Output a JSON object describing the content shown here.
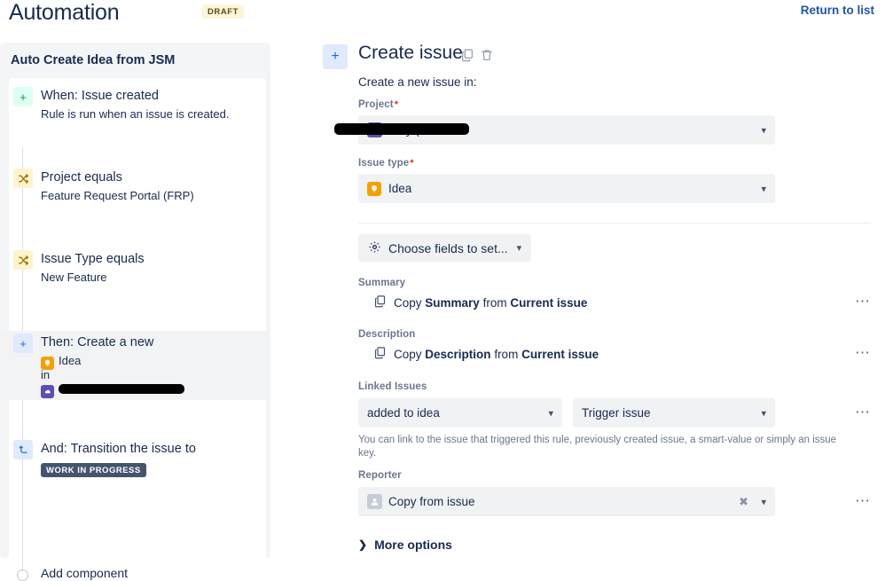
{
  "header": {
    "title": "Automation",
    "status_badge": "DRAFT",
    "return_link": "Return to list"
  },
  "sidebar": {
    "heading": "Auto Create Idea from JSM",
    "steps": [
      {
        "icon": "plus-icon",
        "icon_style": "green",
        "title": "When: Issue created",
        "subtitle": "Rule is run when an issue is created."
      },
      {
        "icon": "condition-branch-icon",
        "icon_style": "yellow",
        "title": "Project equals",
        "subtitle": "Feature Request Portal (FRP)"
      },
      {
        "icon": "condition-branch-icon",
        "icon_style": "yellow",
        "title": "Issue Type equals",
        "subtitle": "New Feature"
      },
      {
        "icon": "plus-icon",
        "icon_style": "blue",
        "title": "Then: Create a new",
        "issue_type": "Idea",
        "in_word": "in",
        "project_redacted": true,
        "selected": true
      },
      {
        "icon": "transition-arrow-icon",
        "icon_style": "blue",
        "title": "And: Transition the issue to",
        "status_badge": "WORK IN PROGRESS"
      }
    ],
    "add_component": "Add component"
  },
  "main": {
    "icon": "plus-icon",
    "title": "Create issue",
    "copy_action": "copy-icon",
    "delete_action": "trash-icon",
    "intro": "Create a new issue in:",
    "project": {
      "label": "Project",
      "required": true,
      "value_redacted": true,
      "value_fragment": "very (OU"
    },
    "issue_type": {
      "label": "Issue type",
      "required": true,
      "value": "Idea"
    },
    "choose_fields": {
      "label": "Choose fields to set...",
      "icon": "gear-icon"
    },
    "fields": [
      {
        "label": "Summary",
        "prefix": "Copy",
        "field": "Summary",
        "middle": "from",
        "source": "Current issue",
        "menu": "more-actions"
      },
      {
        "label": "Description",
        "prefix": "Copy",
        "field": "Description",
        "middle": "from",
        "source": "Current issue",
        "menu": "more-actions"
      }
    ],
    "linked_issues": {
      "label": "Linked Issues",
      "link_type": "added to idea",
      "target": "Trigger issue",
      "help": "You can link to the issue that triggered this rule, previously created issue, a smart-value or simply an issue key."
    },
    "reporter": {
      "label": "Reporter",
      "value": "Copy from issue"
    },
    "more_options": "More options"
  },
  "colors": {
    "accent_blue": "#2154a6",
    "draft_bg": "#fdf5d8",
    "wip_bg": "#44546f",
    "idea_orange": "#f59f00",
    "project_purple": "#5e4db2"
  }
}
